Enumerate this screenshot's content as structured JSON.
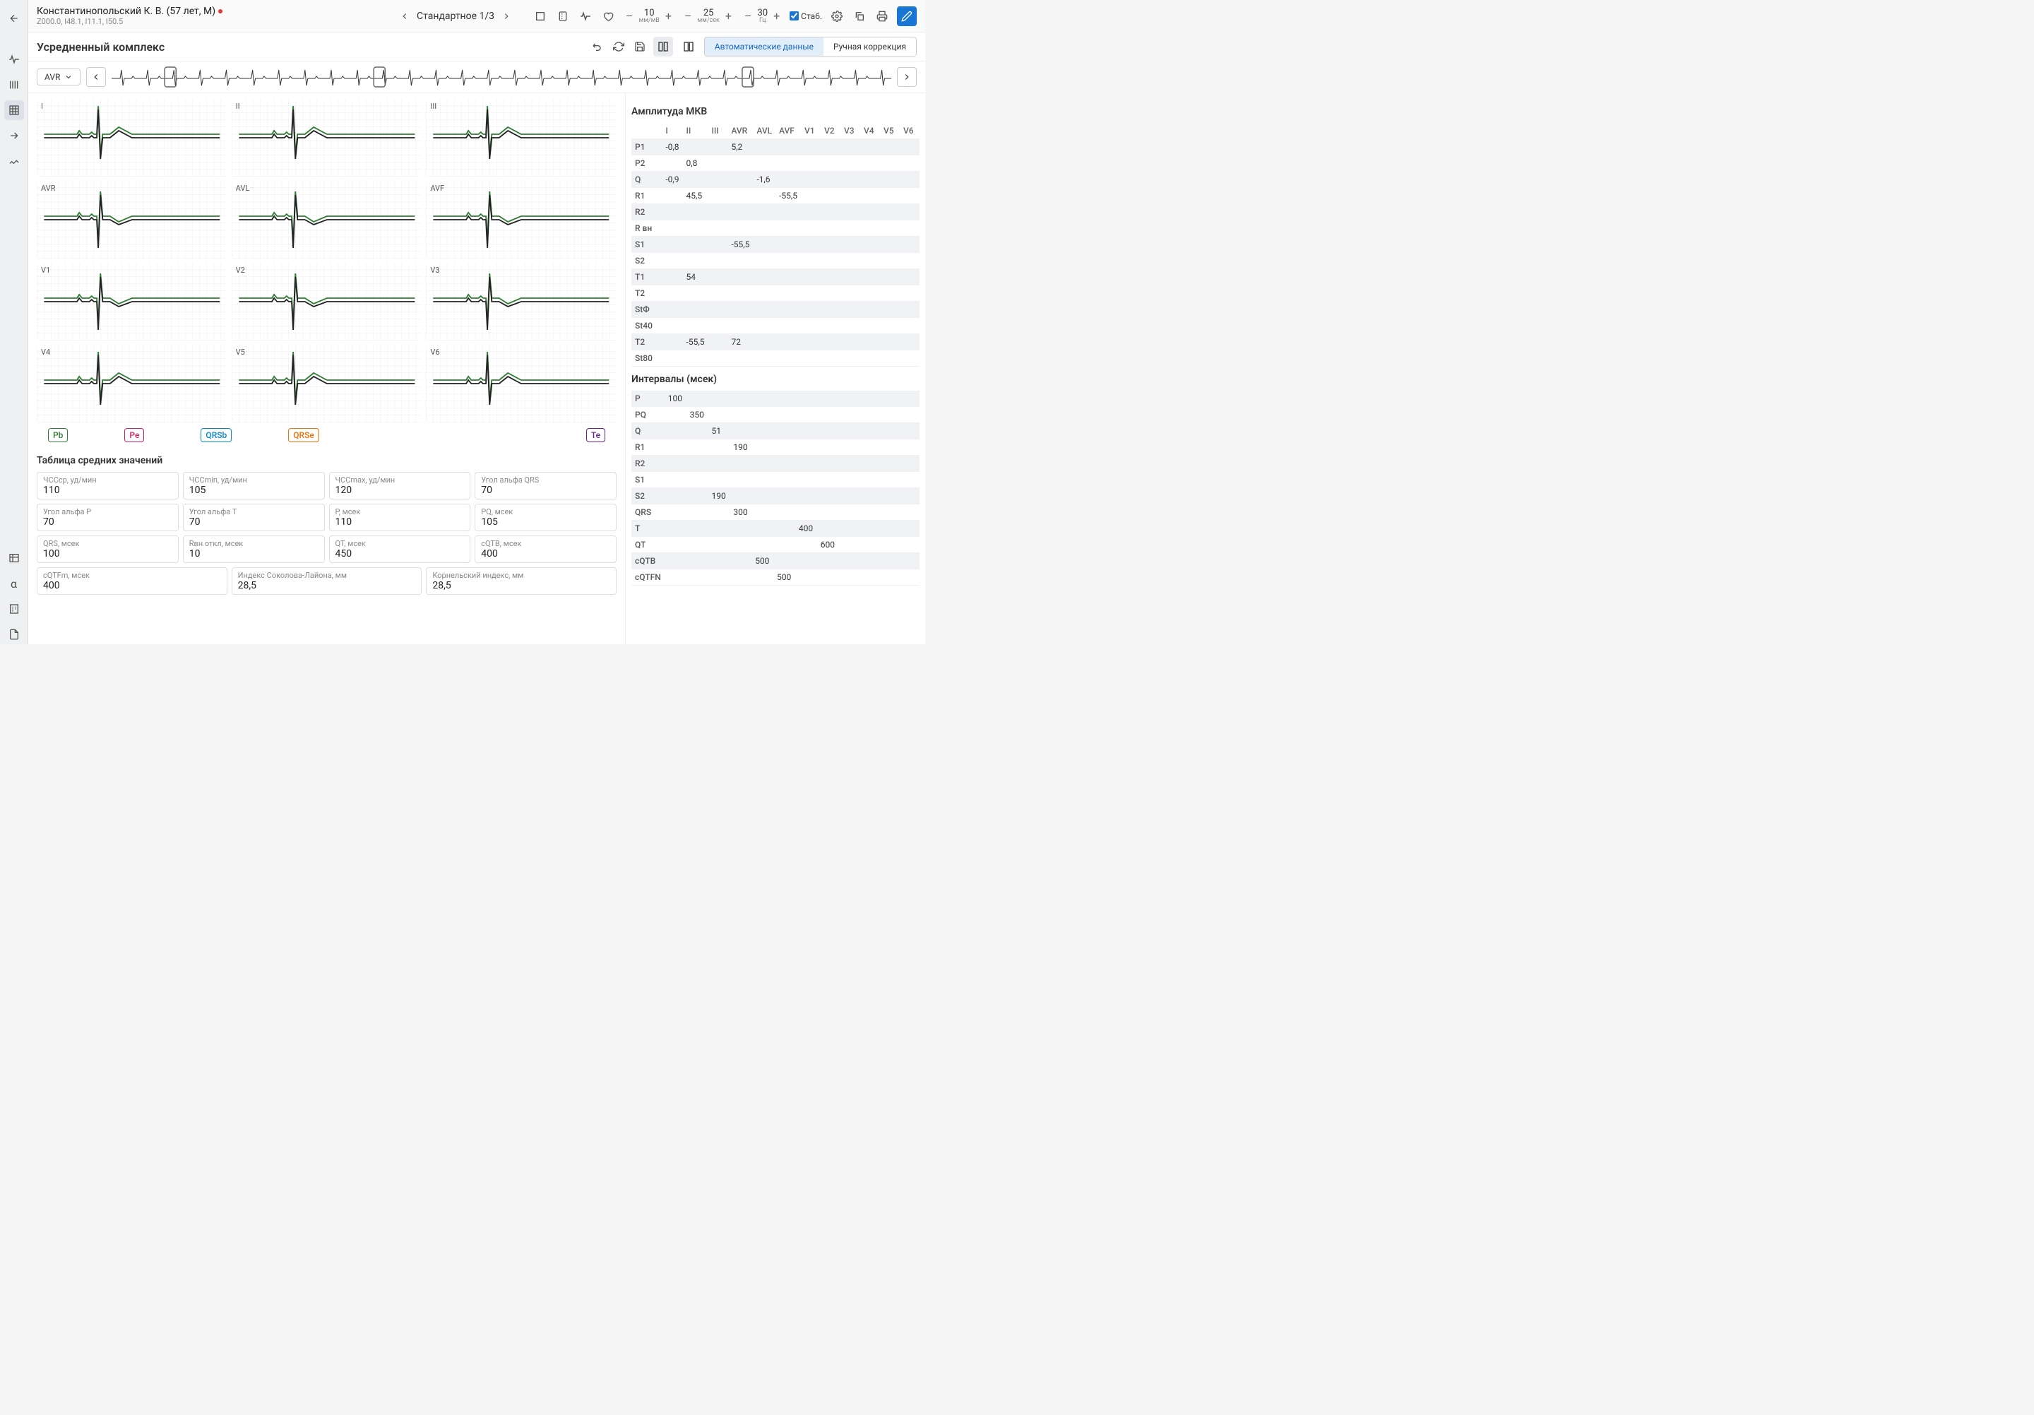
{
  "patient": {
    "name": "Константинопольский К. В. (57 лет, М)",
    "codes": "Z000.0, I48.1, I11.1, I50.5"
  },
  "nav": {
    "label": "Стандартное 1/3"
  },
  "scales": {
    "amp": {
      "value": "10",
      "unit": "мм/мВ"
    },
    "speed": {
      "value": "25",
      "unit": "мм/сек"
    },
    "freq": {
      "value": "30",
      "unit": "Гц"
    }
  },
  "stab": "Стаб.",
  "subtitle": "Усредненный комплекс",
  "toggle": {
    "auto": "Автоматические данные",
    "manual": "Ручная коррекция"
  },
  "leadSelect": "AVR",
  "leads": [
    "I",
    "II",
    "III",
    "AVR",
    "AVL",
    "AVF",
    "V1",
    "V2",
    "V3",
    "V4",
    "V5",
    "V6"
  ],
  "markers": {
    "pb": "Pb",
    "pe": "Pe",
    "qrsb": "QRSb",
    "qrse": "QRSe",
    "te": "Te"
  },
  "tableAvgTitle": "Таблица средних значений",
  "fields": [
    {
      "label": "ЧССср, уд/мин",
      "value": "110"
    },
    {
      "label": "ЧССmin, уд/мин",
      "value": "105"
    },
    {
      "label": "ЧССmax, уд/мин",
      "value": "120"
    },
    {
      "label": "Угол альфа QRS",
      "value": "70"
    },
    {
      "label": "Угол альфа P",
      "value": "70"
    },
    {
      "label": "Угол альфа T",
      "value": "70"
    },
    {
      "label": "P, мсек",
      "value": "110"
    },
    {
      "label": "PQ, мсек",
      "value": "105"
    },
    {
      "label": "QRS, мсек",
      "value": "100"
    },
    {
      "label": "Rвн откл, мсек",
      "value": "10"
    },
    {
      "label": "QT, мсек",
      "value": "450"
    },
    {
      "label": "cQTB, мсек",
      "value": "400"
    }
  ],
  "fields3": [
    {
      "label": "cQTFm, мсек",
      "value": "400"
    },
    {
      "label": "Индекс Соколова-Лайона, мм",
      "value": "28,5"
    },
    {
      "label": "Корнельский индекс, мм",
      "value": "28,5"
    }
  ],
  "ampTitle": "Амплитуда МКВ",
  "ampCols": [
    "I",
    "II",
    "III",
    "AVR",
    "AVL",
    "AVF",
    "V1",
    "V2",
    "V3",
    "V4",
    "V5",
    "V6"
  ],
  "ampRows": [
    {
      "name": "P1",
      "cells": [
        "-0,8",
        "",
        "",
        "5,2",
        "",
        "",
        "",
        "",
        "",
        "",
        "",
        ""
      ]
    },
    {
      "name": "P2",
      "cells": [
        "",
        "0,8",
        "",
        "",
        "",
        "",
        "",
        "",
        "",
        "",
        "",
        ""
      ]
    },
    {
      "name": "Q",
      "cells": [
        "-0,9",
        "",
        "",
        "",
        "-1,6",
        "",
        "",
        "",
        "",
        "",
        "",
        ""
      ]
    },
    {
      "name": "R1",
      "cells": [
        "",
        "45,5",
        "",
        "",
        "",
        "-55,5",
        "",
        "",
        "",
        "",
        "",
        ""
      ]
    },
    {
      "name": "R2",
      "cells": [
        "",
        "",
        "",
        "",
        "",
        "",
        "",
        "",
        "",
        "",
        "",
        ""
      ]
    },
    {
      "name": "R вн",
      "cells": [
        "",
        "",
        "",
        "",
        "",
        "",
        "",
        "",
        "",
        "",
        "",
        ""
      ]
    },
    {
      "name": "S1",
      "cells": [
        "",
        "",
        "",
        "-55,5",
        "",
        "",
        "",
        "",
        "",
        "",
        "",
        ""
      ]
    },
    {
      "name": "S2",
      "cells": [
        "",
        "",
        "",
        "",
        "",
        "",
        "",
        "",
        "",
        "",
        "",
        ""
      ]
    },
    {
      "name": "T1",
      "cells": [
        "",
        "54",
        "",
        "",
        "",
        "",
        "",
        "",
        "",
        "",
        "",
        ""
      ]
    },
    {
      "name": "T2",
      "cells": [
        "",
        "",
        "",
        "",
        "",
        "",
        "",
        "",
        "",
        "",
        "",
        ""
      ]
    },
    {
      "name": "StФ",
      "cells": [
        "",
        "",
        "",
        "",
        "",
        "",
        "",
        "",
        "",
        "",
        "",
        ""
      ]
    },
    {
      "name": "St40",
      "cells": [
        "",
        "",
        "",
        "",
        "",
        "",
        "",
        "",
        "",
        "",
        "",
        ""
      ]
    },
    {
      "name": "T2",
      "cells": [
        "",
        "-55,5",
        "",
        "72",
        "",
        "",
        "",
        "",
        "",
        "",
        "",
        ""
      ]
    },
    {
      "name": "St80",
      "cells": [
        "",
        "",
        "",
        "",
        "",
        "",
        "",
        "",
        "",
        "",
        "",
        ""
      ]
    }
  ],
  "intTitle": "Интервалы (мсек)",
  "intRows": [
    {
      "name": "P",
      "cells": [
        "100",
        "",
        "",
        "",
        "",
        "",
        "",
        "",
        "",
        "",
        "",
        ""
      ]
    },
    {
      "name": "PQ",
      "cells": [
        "",
        "350",
        "",
        "",
        "",
        "",
        "",
        "",
        "",
        "",
        "",
        ""
      ]
    },
    {
      "name": "Q",
      "cells": [
        "",
        "",
        "51",
        "",
        "",
        "",
        "",
        "",
        "",
        "",
        "",
        ""
      ]
    },
    {
      "name": "R1",
      "cells": [
        "",
        "",
        "",
        "190",
        "",
        "",
        "",
        "",
        "",
        "",
        "",
        ""
      ]
    },
    {
      "name": "R2",
      "cells": [
        "",
        "",
        "",
        "",
        "",
        "",
        "",
        "",
        "",
        "",
        "",
        ""
      ]
    },
    {
      "name": "S1",
      "cells": [
        "",
        "",
        "",
        "",
        "",
        "",
        "",
        "",
        "",
        "",
        "",
        ""
      ]
    },
    {
      "name": "S2",
      "cells": [
        "",
        "",
        "190",
        "",
        "",
        "",
        "",
        "",
        "",
        "",
        "",
        ""
      ]
    },
    {
      "name": "QRS",
      "cells": [
        "",
        "",
        "",
        "300",
        "",
        "",
        "",
        "",
        "",
        "",
        "",
        ""
      ]
    },
    {
      "name": "T",
      "cells": [
        "",
        "",
        "",
        "",
        "",
        "",
        "400",
        "",
        "",
        "",
        "",
        ""
      ]
    },
    {
      "name": "QT",
      "cells": [
        "",
        "",
        "",
        "",
        "",
        "",
        "",
        "600",
        "",
        "",
        "",
        ""
      ]
    },
    {
      "name": "cQTB",
      "cells": [
        "",
        "",
        "",
        "",
        "500",
        "",
        "",
        "",
        "",
        "",
        "",
        ""
      ]
    },
    {
      "name": "cQTFN",
      "cells": [
        "",
        "",
        "",
        "",
        "",
        "500",
        "",
        "",
        "",
        "",
        "",
        ""
      ]
    }
  ]
}
